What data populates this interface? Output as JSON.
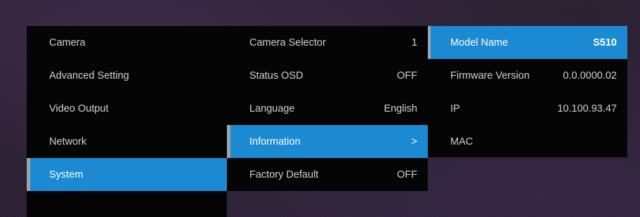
{
  "menu": {
    "main": [
      {
        "label": "Camera"
      },
      {
        "label": "Advanced Setting"
      },
      {
        "label": "Video Output"
      },
      {
        "label": "Network"
      },
      {
        "label": "System",
        "selected": true
      }
    ],
    "system": [
      {
        "label": "Camera Selector",
        "value": "1"
      },
      {
        "label": "Status OSD",
        "value": "OFF"
      },
      {
        "label": "Language",
        "value": "English"
      },
      {
        "label": "Information",
        "value": ">",
        "selected": true
      },
      {
        "label": "Factory Default",
        "value": "OFF"
      }
    ],
    "information": [
      {
        "label": "Model Name",
        "value": "S510",
        "selected": true
      },
      {
        "label": "Firmware Version",
        "value": "0.0.0000.02"
      },
      {
        "label": "IP",
        "value": "10.100.93.47"
      },
      {
        "label": "MAC",
        "value": ""
      }
    ]
  },
  "colors": {
    "highlight": "#1b8ad3",
    "panel": "#050506",
    "text": "#d0d0d0"
  }
}
